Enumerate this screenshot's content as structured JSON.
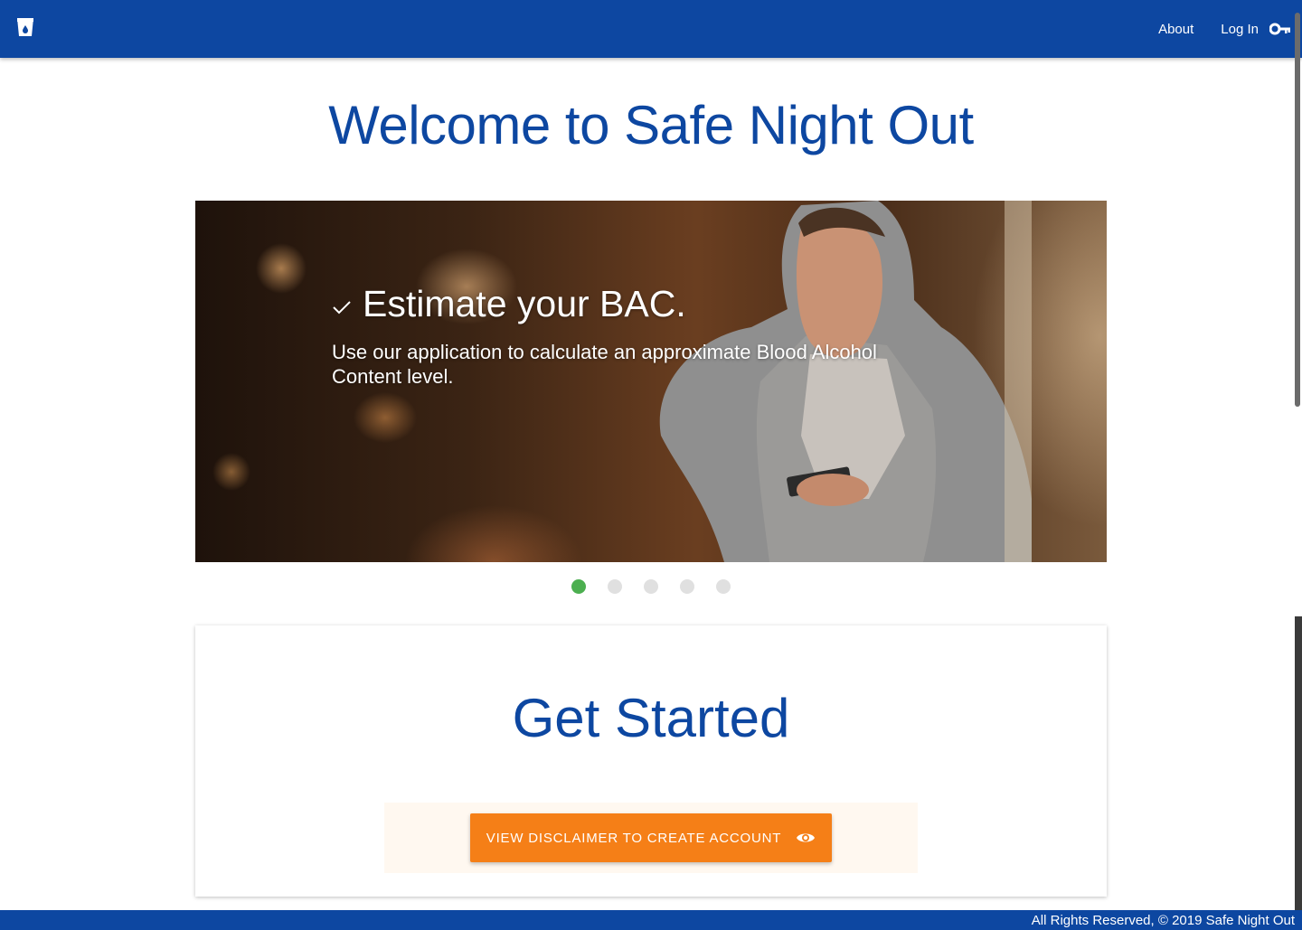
{
  "nav": {
    "about_label": "About",
    "login_label": "Log In"
  },
  "page": {
    "title": "Welcome to Safe Night Out"
  },
  "carousel": {
    "slide": {
      "heading": "Estimate your BAC.",
      "description": "Use our application to calculate an approximate Blood Alcohol Content level."
    },
    "slide_count": 5,
    "active_index": 0
  },
  "get_started": {
    "title": "Get Started",
    "button_label": "VIEW DISCLAIMER TO CREATE ACCOUNT"
  },
  "footer": {
    "text": "All Rights Reserved, © 2019 Safe Night Out"
  },
  "icons": {
    "logo": "cup-drop-icon",
    "login": "key-icon",
    "slide": "check-icon",
    "button": "eye-icon"
  },
  "colors": {
    "primary": "#0d47a1",
    "accent": "#f57f17",
    "active_dot": "#4caf50",
    "inactive_dot": "#e0e0e0"
  }
}
